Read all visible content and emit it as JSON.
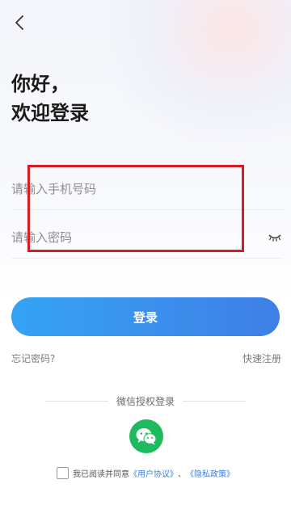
{
  "greeting": {
    "line1": "你好，",
    "line2": "欢迎登录"
  },
  "form": {
    "phone_placeholder": "请输入手机号码",
    "password_placeholder": "请输入密码",
    "login_label": "登录"
  },
  "links": {
    "forgot": "忘记密码?",
    "register": "快速注册"
  },
  "wechat": {
    "divider_text": "微信授权登录"
  },
  "agreement": {
    "prefix": "我已阅读并同意",
    "user_agreement": "《用户协议》",
    "separator": "、",
    "privacy_policy": "《隐私政策》"
  },
  "icons": {
    "back": "chevron-left-icon",
    "password_toggle": "eye-closed-icon",
    "wechat": "wechat-icon"
  },
  "colors": {
    "primary_start": "#35a3f5",
    "primary_end": "#3f7fe5",
    "wechat_green": "#1fba5e",
    "link_blue": "#3b7fe0",
    "highlight_red": "#d41e24"
  }
}
